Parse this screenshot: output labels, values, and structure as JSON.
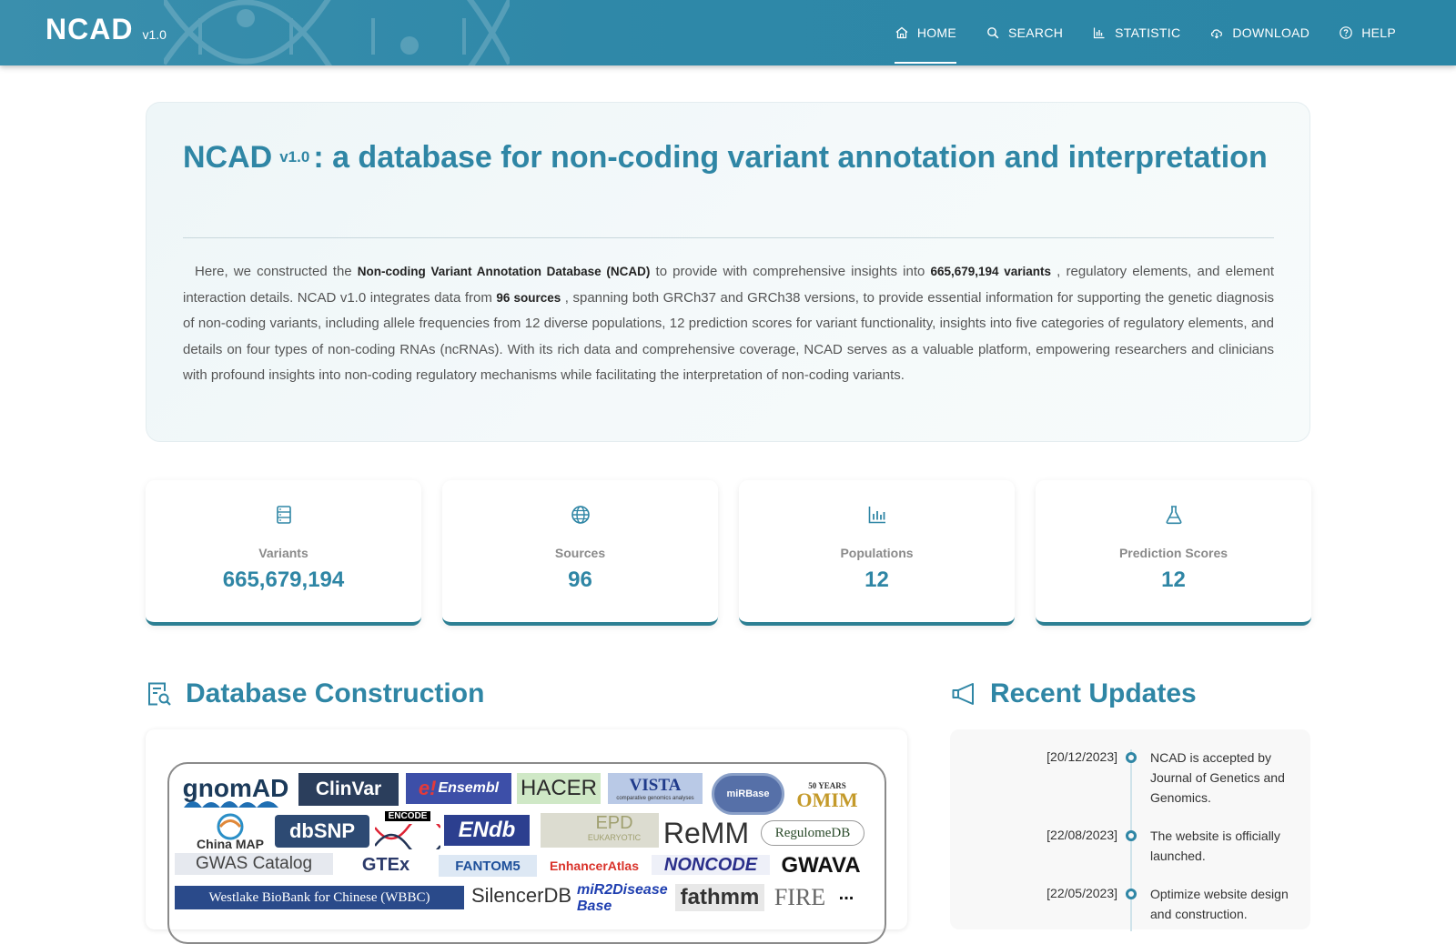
{
  "header": {
    "brand": "NCAD",
    "version": "v1.0",
    "nav": [
      {
        "label": "HOME",
        "icon": "home-icon"
      },
      {
        "label": "SEARCH",
        "icon": "search-icon"
      },
      {
        "label": "STATISTIC",
        "icon": "bar-chart-icon"
      },
      {
        "label": "DOWNLOAD",
        "icon": "cloud-download-icon"
      },
      {
        "label": "HELP",
        "icon": "help-circle-icon"
      }
    ],
    "active_nav": "HOME"
  },
  "hero": {
    "title_main": "NCAD",
    "title_version": "v1.0",
    "title_rest": ": a database for non-coding variant annotation and interpretation",
    "text_1": "Here, we constructed the ",
    "bold_1": "Non-coding Variant Annotation Database (NCAD)",
    "text_2": " to provide with comprehensive insights into ",
    "bold_2": "665,679,194 variants",
    "text_3": " , regulatory elements, and element interaction details. NCAD v1.0 integrates data from ",
    "bold_3": "96 sources",
    "text_4": " , spanning both GRCh37 and GRCh38 versions, to provide essential information for supporting the genetic diagnosis of non-coding variants, including allele frequencies from 12 diverse populations, 12 prediction scores for variant functionality, insights into five categories of regulatory elements, and details on four types of non-coding RNAs (ncRNAs). With its rich data and comprehensive coverage, NCAD serves as a valuable platform, empowering researchers and clinicians with profound insights into non-coding regulatory mechanisms while facilitating the interpretation of non-coding variants."
  },
  "stats": [
    {
      "label": "Variants",
      "value": "665,679,194",
      "icon": "database-icon"
    },
    {
      "label": "Sources",
      "value": "96",
      "icon": "globe-icon"
    },
    {
      "label": "Populations",
      "value": "12",
      "icon": "bar-chart-icon"
    },
    {
      "label": "Prediction Scores",
      "value": "12",
      "icon": "flask-icon"
    }
  ],
  "sections": {
    "construction_title": "Database Construction",
    "updates_title": "Recent Updates"
  },
  "logos": {
    "gnomad": "gnomAD",
    "clinvar": "ClinVar",
    "ensembl": "Ensembl",
    "hacer": "HACER",
    "vista": "VISTA",
    "vista_sub": "comparative genomics analyses",
    "mirbase": "miRBase",
    "omim": "OMIM",
    "omim_years": "50 YEARS",
    "chinamap": "China MAP",
    "dbsnp": "dbSNP",
    "encode": "ENCODE",
    "endb": "ENdb",
    "epd": "EPD",
    "epd_sub": "EUKARYOTIC",
    "remm": "ReMM",
    "regulomedb": "RegulomeDB",
    "gwas": "GWAS Catalog",
    "gtex": "GTEx",
    "fantom": "FANTOM5",
    "enhanceratlas": "EnhancerAtlas",
    "noncode": "NONCODE",
    "gwava": "GWAVA",
    "wbbc": "Westlake BioBank for Chinese (WBBC)",
    "silencerdb": "SilencerDB",
    "mir2disease": "miR2Disease Base",
    "fathmm": "fathmm",
    "fire": "FIRE",
    "more": "..."
  },
  "colors": {
    "primary": "#2f86a5",
    "header": "#2f88a8"
  },
  "updates": [
    {
      "date": "[20/12/2023]",
      "text": "NCAD is accepted by Journal of Genetics and Genomics."
    },
    {
      "date": "[22/08/2023]",
      "text": "The website is officially launched."
    },
    {
      "date": "[22/05/2023]",
      "text": "Optimize website design and construction."
    }
  ]
}
